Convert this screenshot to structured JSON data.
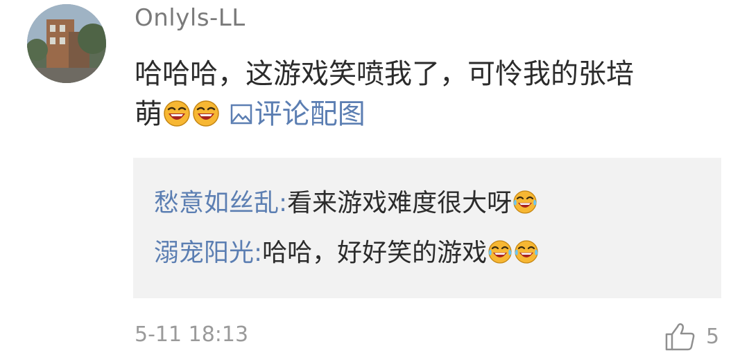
{
  "comment": {
    "username": "Onlyls-LL",
    "text_line1": "哈哈哈，这游戏笑喷我了，可怜我的张培",
    "text_line2": "萌",
    "emojis": [
      "laughing-face-icon",
      "laughing-face-icon"
    ],
    "image_link_label": "评论配图",
    "timestamp": "5-11 18:13",
    "like_count": "5"
  },
  "replies": [
    {
      "author": "愁意如丝乱",
      "separator": ":",
      "text": "看来游戏难度很大呀",
      "emojis": [
        "tears-of-joy-icon"
      ]
    },
    {
      "author": "溺宠阳光",
      "separator": ":",
      "text": "哈哈，好好笑的游戏",
      "emojis": [
        "tears-of-joy-icon",
        "tears-of-joy-icon"
      ]
    }
  ],
  "colors": {
    "link_blue": "#5b7eb2",
    "reply_bg": "#f2f2f2",
    "meta_gray": "#9a9a9a"
  }
}
